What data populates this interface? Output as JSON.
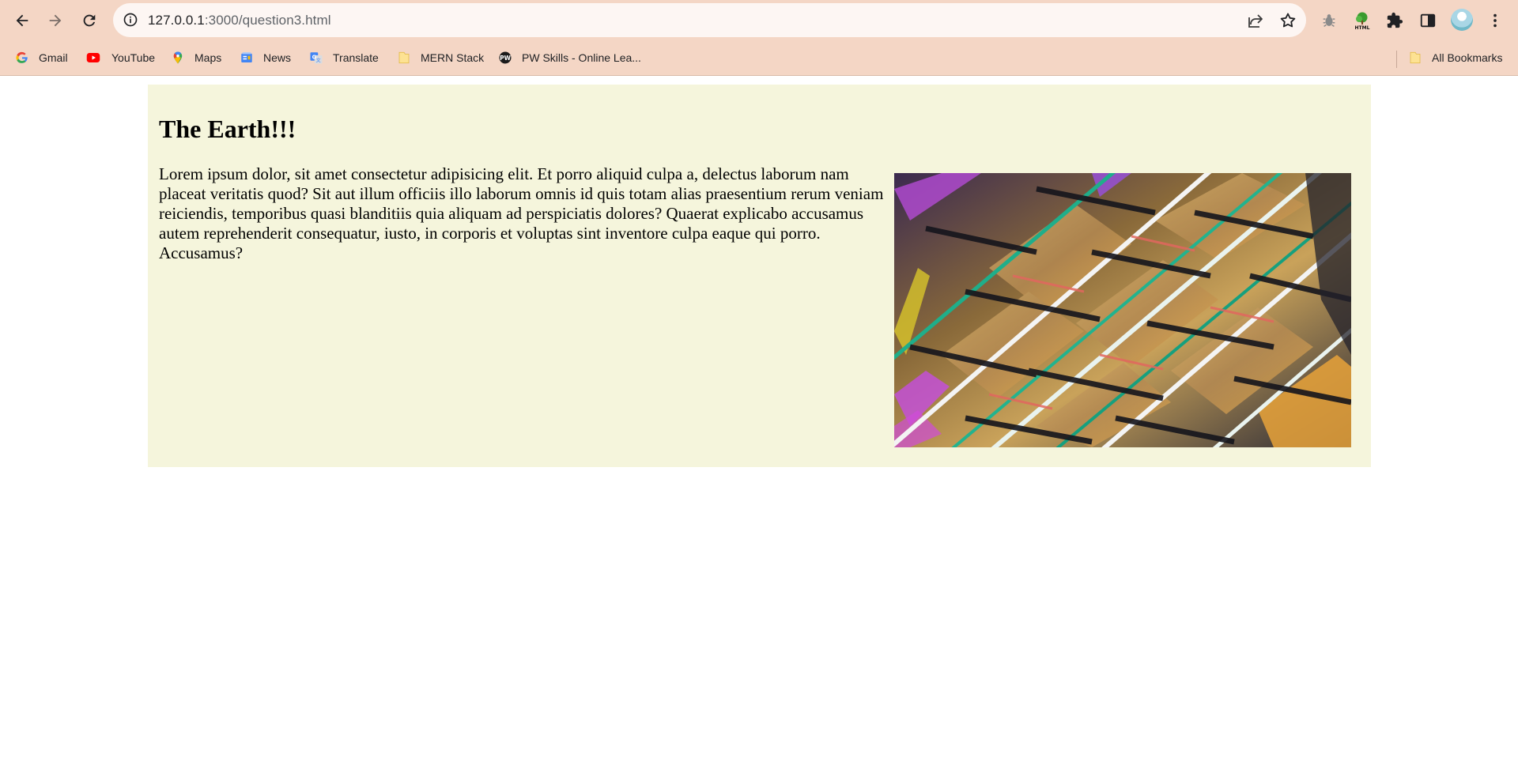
{
  "browser": {
    "url_host": "127.0.0.1",
    "url_path": ":3000/question3.html"
  },
  "bookmarks": [
    {
      "label": "Gmail",
      "icon": "gmail-icon"
    },
    {
      "label": "YouTube",
      "icon": "youtube-icon"
    },
    {
      "label": "Maps",
      "icon": "maps-icon"
    },
    {
      "label": "News",
      "icon": "news-icon"
    },
    {
      "label": "Translate",
      "icon": "translate-icon"
    },
    {
      "label": "MERN Stack",
      "icon": "folder-icon"
    },
    {
      "label": "PW Skills - Online Lea...",
      "icon": "pw-skills-icon"
    }
  ],
  "all_bookmarks": {
    "label": "All Bookmarks",
    "icon": "folder-icon"
  },
  "page": {
    "heading": "The Earth!!!",
    "paragraph": "Lorem ipsum dolor, sit amet consectetur adipisicing elit. Et porro aliquid culpa a, delectus laborum nam placeat veritatis quod? Sit aut illum officiis illo laborum omnis id quis totam alias praesentium rerum veniam reiciendis, temporibus quasi blanditiis quia aliquam ad perspiciatis dolores? Quaerat explicabo accusamus autem reprehenderit consequatur, iusto, in corporis et voluptas sint inventore culpa eaque qui porro. Accusamus?",
    "image_icon": "abstract-glass-building-image"
  },
  "colors": {
    "chrome_bg": "#f4d6c5",
    "panel_bg": "#f5f5dc"
  }
}
